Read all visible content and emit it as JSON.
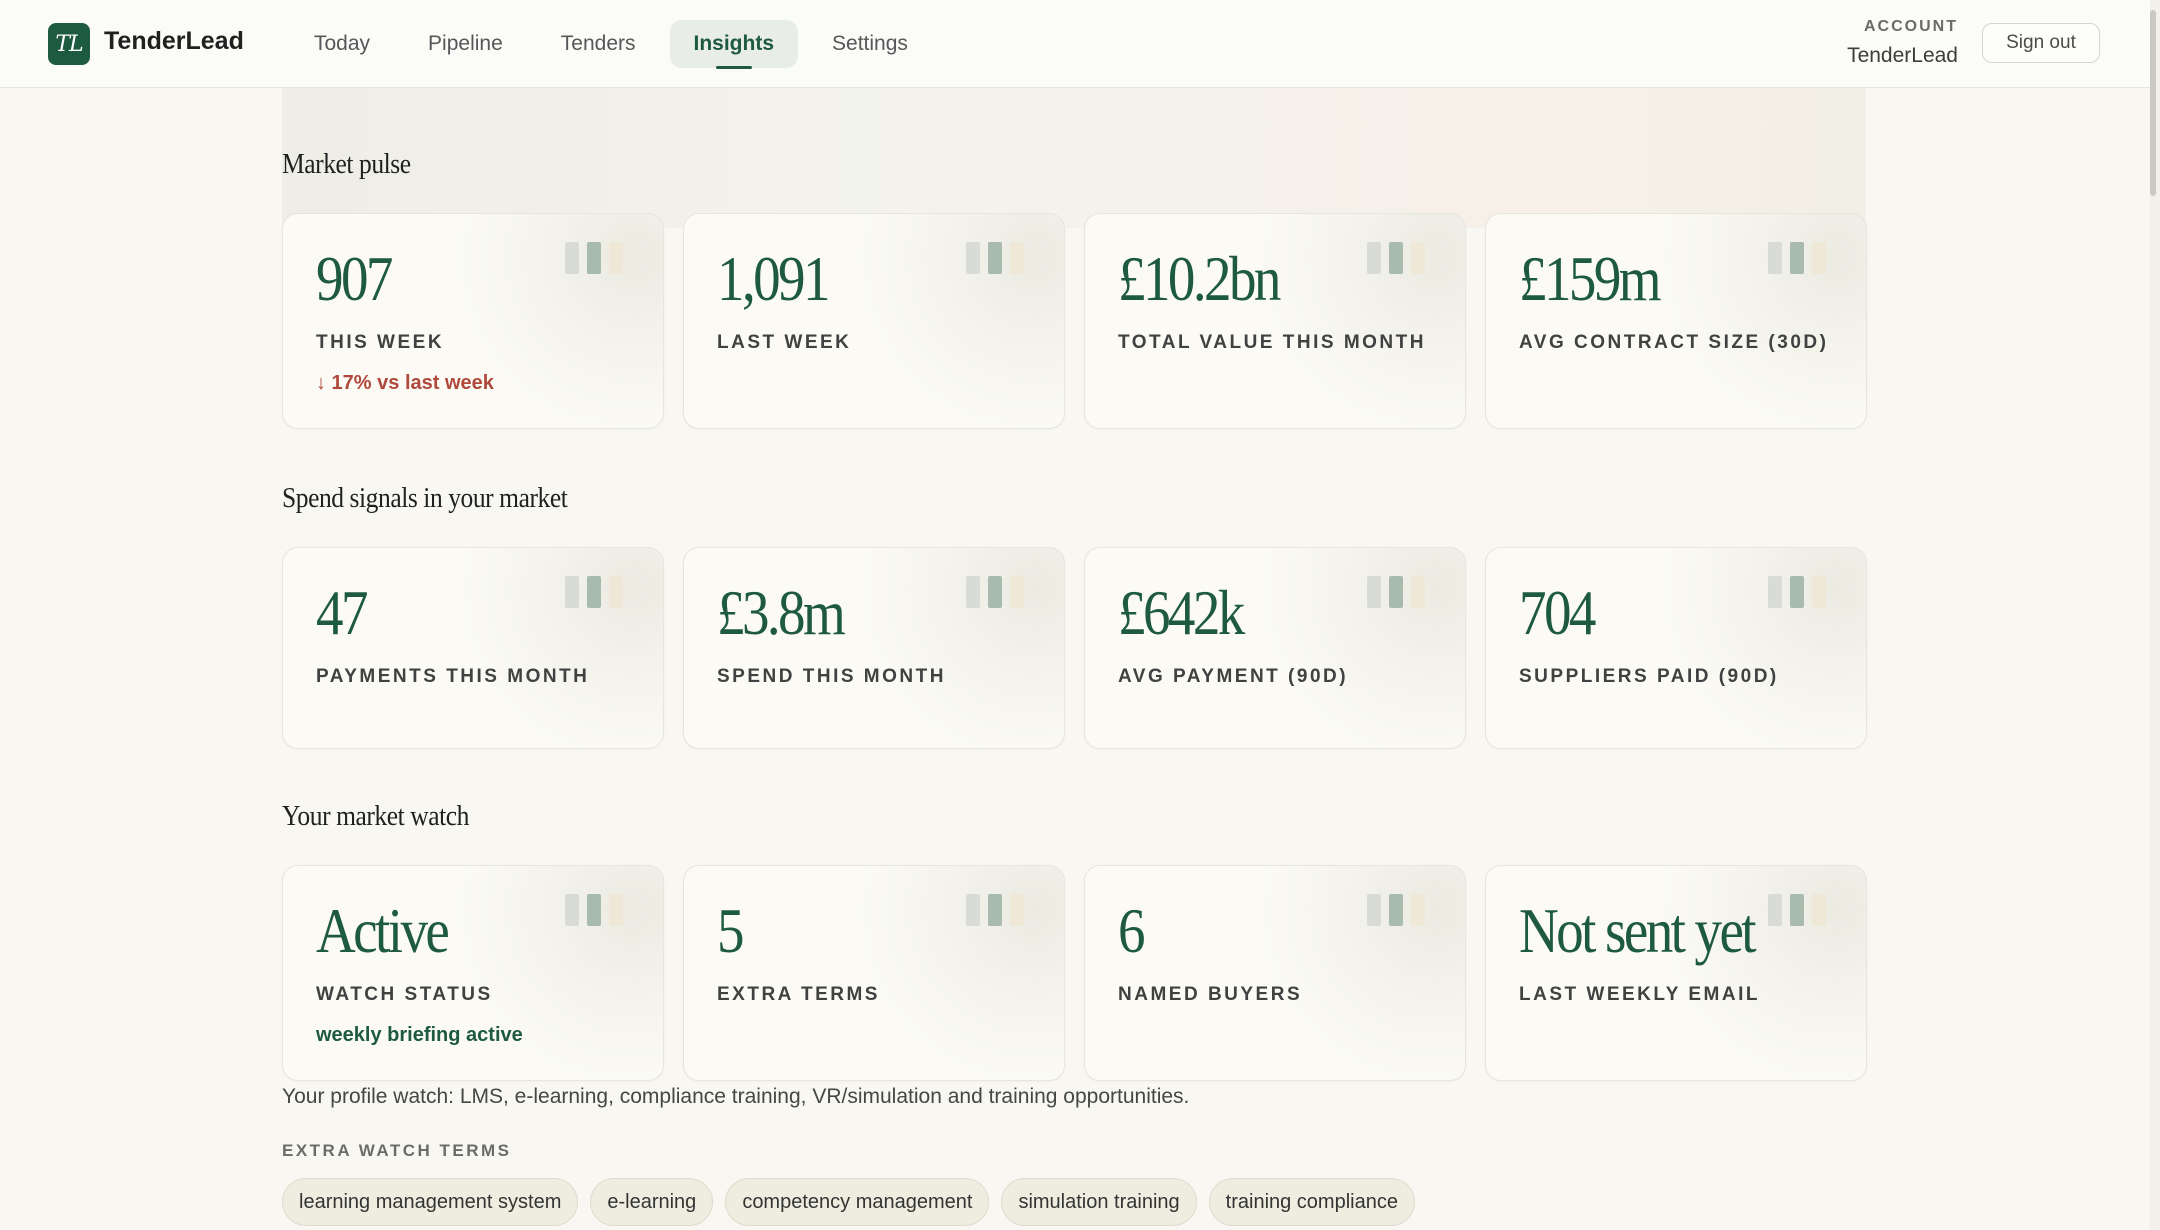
{
  "nav": {
    "logo": "TL",
    "brand": "TenderLead",
    "links": [
      "Today",
      "Pipeline",
      "Tenders",
      "Insights",
      "Settings"
    ],
    "active": "Insights",
    "account_label": "ACCOUNT",
    "account_name": "TenderLead",
    "signout": "Sign out"
  },
  "sections": {
    "market_pulse": {
      "title": "Market pulse",
      "cards": [
        {
          "value": "907",
          "label": "THIS WEEK",
          "sub": "↓ 17% vs last week"
        },
        {
          "value": "1,091",
          "label": "LAST WEEK"
        },
        {
          "value": "£10.2bn",
          "label": "TOTAL VALUE THIS MONTH"
        },
        {
          "value": "£159m",
          "label": "AVG CONTRACT SIZE (30D)"
        }
      ]
    },
    "spend_signals": {
      "title": "Spend signals in your market",
      "cards": [
        {
          "value": "47",
          "label": "PAYMENTS THIS MONTH"
        },
        {
          "value": "£3.8m",
          "label": "SPEND THIS MONTH"
        },
        {
          "value": "£642k",
          "label": "AVG PAYMENT (90D)"
        },
        {
          "value": "704",
          "label": "SUPPLIERS PAID (90D)"
        }
      ]
    },
    "market_watch": {
      "title": "Your market watch",
      "cards": [
        {
          "value": "Active",
          "label": "WATCH STATUS",
          "sub": "weekly briefing active"
        },
        {
          "value": "5",
          "label": "EXTRA TERMS"
        },
        {
          "value": "6",
          "label": "NAMED BUYERS"
        },
        {
          "value": "Not sent yet",
          "label": "LAST WEEKLY EMAIL"
        }
      ]
    }
  },
  "profile_watch": "Your profile watch: LMS, e-learning, compliance training, VR/simulation and training opportunities.",
  "extra_terms_label": "EXTRA WATCH TERMS",
  "extra_terms": [
    "learning management system",
    "e-learning",
    "competency management",
    "simulation training",
    "training compliance"
  ],
  "colors": {
    "accent": "#1e5a40",
    "down": "#b0493c",
    "background": "#f8f7f1"
  }
}
